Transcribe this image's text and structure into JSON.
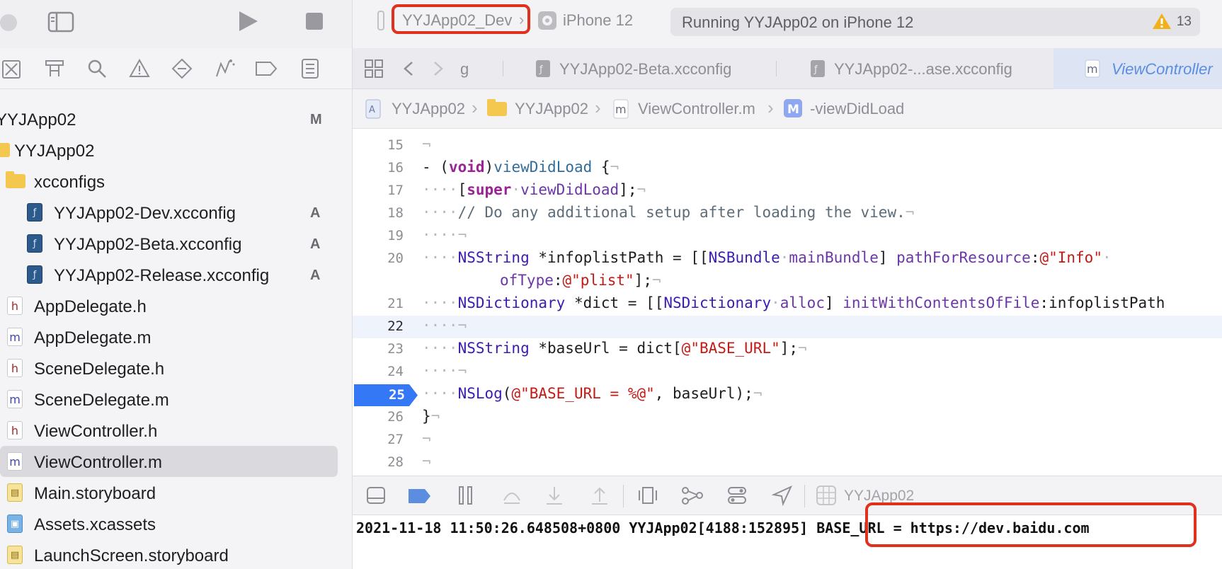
{
  "toolbar": {
    "scheme": "YYJApp02_Dev",
    "device": "iPhone 12",
    "status": "Running YYJApp02 on iPhone 12",
    "warning_count": "13"
  },
  "navigator": {
    "items": [
      {
        "label": "YYJApp02",
        "badge": "M"
      },
      {
        "label": "YYJApp02",
        "badge": ""
      },
      {
        "label": "xcconfigs",
        "badge": ""
      },
      {
        "label": "YYJApp02-Dev.xcconfig",
        "badge": "A"
      },
      {
        "label": "YYJApp02-Beta.xcconfig",
        "badge": "A"
      },
      {
        "label": "YYJApp02-Release.xcconfig",
        "badge": "A"
      },
      {
        "label": "AppDelegate.h",
        "badge": ""
      },
      {
        "label": "AppDelegate.m",
        "badge": ""
      },
      {
        "label": "SceneDelegate.h",
        "badge": ""
      },
      {
        "label": "SceneDelegate.m",
        "badge": ""
      },
      {
        "label": "ViewController.h",
        "badge": ""
      },
      {
        "label": "ViewController.m",
        "badge": ""
      },
      {
        "label": "Main.storyboard",
        "badge": ""
      },
      {
        "label": "Assets.xcassets",
        "badge": ""
      },
      {
        "label": "LaunchScreen.storyboard",
        "badge": ""
      }
    ]
  },
  "tabs": [
    {
      "label": "g"
    },
    {
      "label": "YYJApp02-Beta.xcconfig"
    },
    {
      "label": "YYJApp02-...ase.xcconfig"
    },
    {
      "label": "ViewController"
    }
  ],
  "jumpbar": {
    "project": "YYJApp02",
    "group": "YYJApp02",
    "file": "ViewController.m",
    "symbol": "-viewDidLoad"
  },
  "editor": {
    "line_numbers": [
      "15",
      "16",
      "17",
      "18",
      "19",
      "20",
      "21",
      "22",
      "23",
      "24",
      "25",
      "26",
      "27",
      "28"
    ],
    "breakpoint_line": "25",
    "lines": {
      "l16_dash": "- ",
      "l16_open": "(",
      "l16_void": "void",
      "l16_close": ")",
      "l16_name": "viewDidLoad",
      "l16_rest": " {",
      "l17_open": "[",
      "l17_super": "super",
      "l17_msg": "viewDidLoad",
      "l17_rest": "];",
      "l18_comment": "// Do any additional setup after loading the view.",
      "l20_type": "NSString",
      "l20_var": " *infoplistPath = [[",
      "l20_bundle": "NSBundle",
      "l20_main": "mainBundle",
      "l20_mid": "] ",
      "l20_path": "pathForResource",
      "l20_colon": ":",
      "l20_str": "@\"Info\"",
      "l20b_oftype": "ofType",
      "l20b_colon": ":",
      "l20b_str": "@\"plist\"",
      "l20b_rest": "];",
      "l21_type": "NSDictionary",
      "l21_var": " *dict = [[",
      "l21_cls": "NSDictionary",
      "l21_alloc": "alloc",
      "l21_mid": "] ",
      "l21_init": "initWithContentsOfFile",
      "l21_rest": ":infoplistPath",
      "l23_type": "NSString",
      "l23_var": " *baseUrl = dict[",
      "l23_str": "@\"BASE_URL\"",
      "l23_rest": "];",
      "l25_fn": "NSLog",
      "l25_open": "(",
      "l25_str": "@\"BASE_URL = %@\"",
      "l25_rest": ", baseUrl);",
      "l26_brace": "}"
    }
  },
  "debugbar": {
    "target": "YYJApp02"
  },
  "console": {
    "log_prefix": "2021-11-18 11:50:26.648508+0800 YYJApp02[4188:152895] ",
    "log_value": "BASE_URL = https://dev.baidu.com"
  },
  "colors": {
    "highlight_red": "#e0301e",
    "breakpoint_blue": "#3478f6",
    "active_tab": "#5b8de0"
  }
}
